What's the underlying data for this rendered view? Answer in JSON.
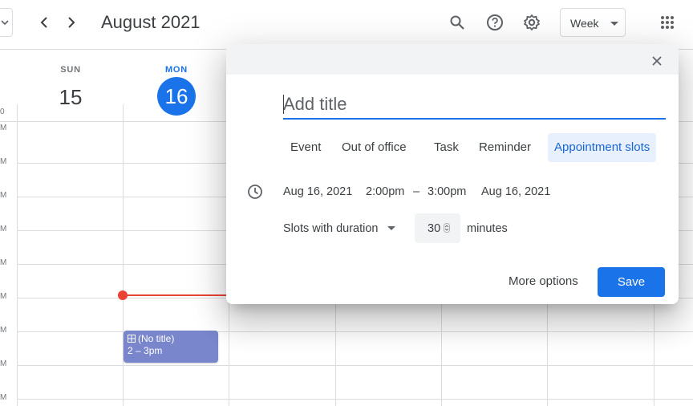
{
  "header": {
    "month_title": "August 2021",
    "view_label": "Week",
    "icons": [
      "chevron-left-icon",
      "chevron-right-icon",
      "search-icon",
      "help-icon",
      "settings-icon",
      "apps-grid-icon"
    ]
  },
  "days": [
    {
      "dow": "SUN",
      "num": "15"
    },
    {
      "dow": "MON",
      "num": "16",
      "is_today": true
    }
  ],
  "hour_labels": [
    "0",
    "M",
    "M",
    "M",
    "M",
    "M",
    "M",
    "M",
    "M",
    "M"
  ],
  "event": {
    "title": "(No title)",
    "time": "2 – 3pm",
    "color": "#7986cb"
  },
  "dialog": {
    "title_placeholder": "Add title",
    "tabs": [
      "Event",
      "Out of office",
      "Task",
      "Reminder",
      "Appointment slots"
    ],
    "active_tab": "Appointment slots",
    "start_date": "Aug 16, 2021",
    "start_time": "2:00pm",
    "dash": "–",
    "end_time": "3:00pm",
    "end_date": "Aug 16, 2021",
    "slots_label": "Slots with duration",
    "duration": "30",
    "minutes_label": "minutes",
    "more_options": "More options",
    "save": "Save"
  },
  "colors": {
    "accent": "#1a73e8",
    "now_line": "#ea4335",
    "grid": "#dadce0"
  }
}
